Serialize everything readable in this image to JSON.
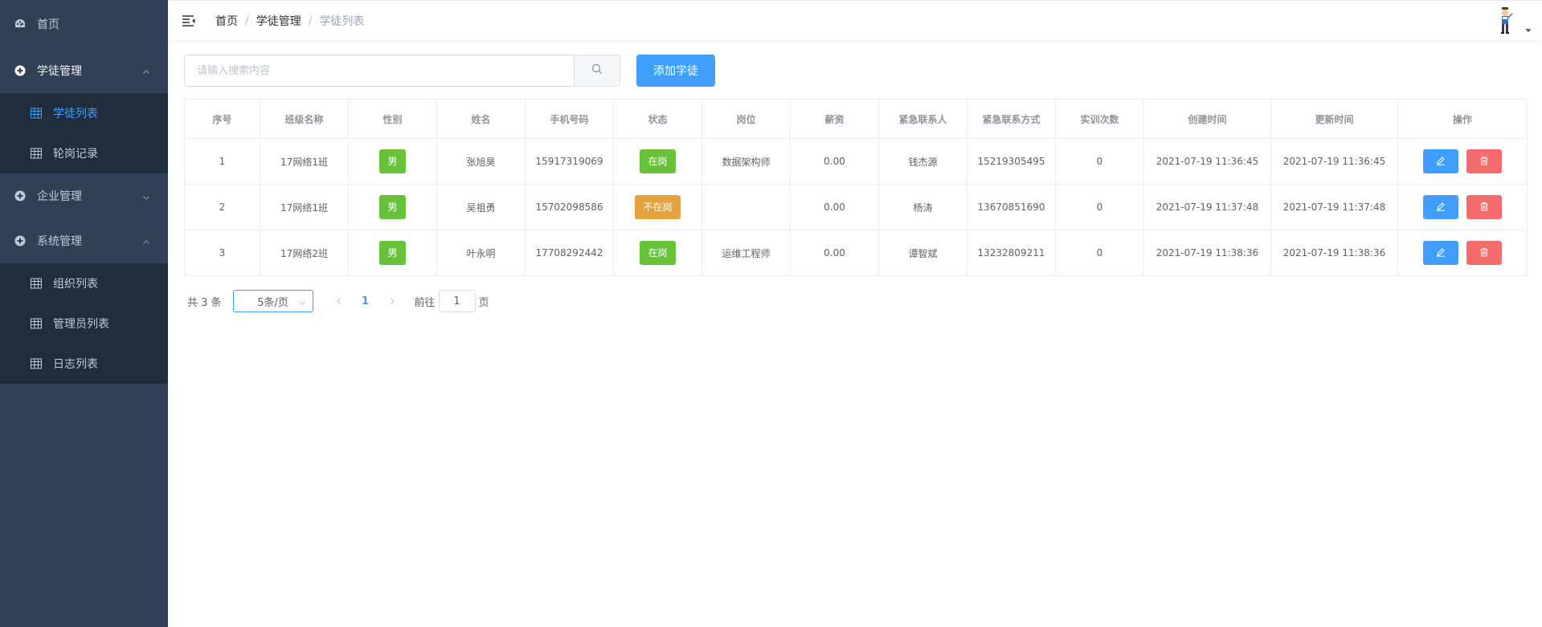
{
  "sidebar": {
    "home": {
      "label": "首页",
      "icon": "dashboard-icon"
    },
    "groups": [
      {
        "label": "学徒管理",
        "icon": "plus-circle-icon",
        "expanded": true,
        "items": [
          {
            "label": "学徒列表",
            "active": true
          },
          {
            "label": "轮岗记录",
            "active": false
          }
        ]
      },
      {
        "label": "企业管理",
        "icon": "plus-circle-icon",
        "expanded": false,
        "items": []
      },
      {
        "label": "系统管理",
        "icon": "plus-circle-icon",
        "expanded": true,
        "items": [
          {
            "label": "组织列表",
            "active": false
          },
          {
            "label": "管理员列表",
            "active": false
          },
          {
            "label": "日志列表",
            "active": false
          }
        ]
      }
    ],
    "colors": {
      "bg": "#304156",
      "submenu_bg": "#1f2d3d",
      "text": "#bfcbd9",
      "active": "#409eff"
    }
  },
  "breadcrumb": [
    "首页",
    "学徒管理",
    "学徒列表"
  ],
  "search": {
    "placeholder": "请输入搜索内容",
    "value": ""
  },
  "add_button_label": "添加学徒",
  "table": {
    "columns": [
      "序号",
      "班级名称",
      "性别",
      "姓名",
      "手机号码",
      "状态",
      "岗位",
      "薪资",
      "紧急联系人",
      "紧急联系方式",
      "实训次数",
      "创建时间",
      "更新时间",
      "操作"
    ],
    "rows": [
      {
        "index": "1",
        "class_name": "17网络1班",
        "gender": "男",
        "name": "张旭昊",
        "phone": "15917319069",
        "status": "在岗",
        "status_color": "green",
        "position": "数据架构师",
        "salary": "0.00",
        "emergency_contact": "钱杰源",
        "emergency_phone": "15219305495",
        "training_count": "0",
        "created": "2021-07-19 11:36:45",
        "updated": "2021-07-19 11:36:45"
      },
      {
        "index": "2",
        "class_name": "17网络1班",
        "gender": "男",
        "name": "吴祖勇",
        "phone": "15702098586",
        "status": "不在岗",
        "status_color": "orange",
        "position": "",
        "salary": "0.00",
        "emergency_contact": "杨涛",
        "emergency_phone": "13670851690",
        "training_count": "0",
        "created": "2021-07-19 11:37:48",
        "updated": "2021-07-19 11:37:48"
      },
      {
        "index": "3",
        "class_name": "17网络2班",
        "gender": "男",
        "name": "叶永明",
        "phone": "17708292442",
        "status": "在岗",
        "status_color": "green",
        "position": "运维工程师",
        "salary": "0.00",
        "emergency_contact": "谭智斌",
        "emergency_phone": "13232809211",
        "training_count": "0",
        "created": "2021-07-19 11:38:36",
        "updated": "2021-07-19 11:38:36"
      }
    ]
  },
  "pagination": {
    "total_label": "共 3 条",
    "page_size_label": "5条/页",
    "current_page": "1",
    "goto_prefix": "前往",
    "goto_value": "1",
    "goto_suffix": "页"
  },
  "colors": {
    "primary": "#409eff",
    "success": "#67c23a",
    "warning": "#e6a23c",
    "danger": "#f56c6c"
  }
}
